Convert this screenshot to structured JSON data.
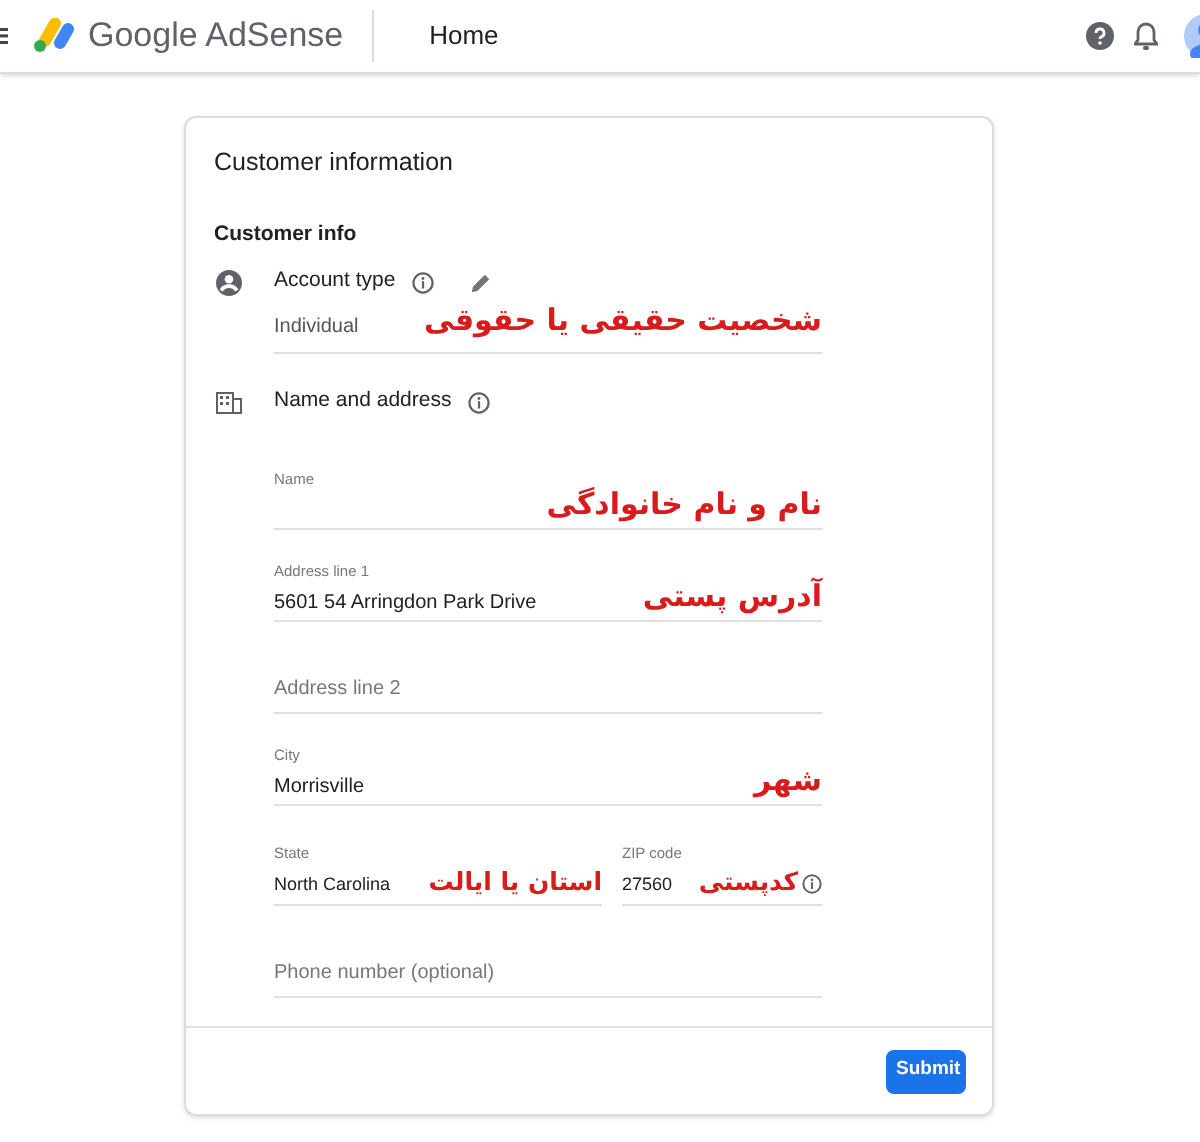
{
  "header": {
    "product": "Google AdSense",
    "page": "Home"
  },
  "card": {
    "title": "Customer information",
    "section": "Customer info",
    "account": {
      "label": "Account type",
      "value": "Individual",
      "annotation": "شخصیت حقیقی یا حقوقی"
    },
    "address_heading": "Name and address",
    "fields": [
      {
        "kind": "filled",
        "label": "Name",
        "annotation": "نام و نام خانوادگی"
      },
      {
        "kind": "filled",
        "label": "Address line 1",
        "value": "5601  54 Arringdon Park Drive",
        "annotation": "آدرس پستی"
      },
      {
        "kind": "empty",
        "placeholder": "Address line 2"
      },
      {
        "kind": "filled",
        "label": "City",
        "value": "Morrisville",
        "annotation": "شهر"
      }
    ],
    "state": {
      "label": "State",
      "value": "North Carolina",
      "annotation": "استان یا ایالت"
    },
    "zip": {
      "label": "ZIP code",
      "value": "27560",
      "annotation": "کدپستی"
    },
    "phone": {
      "placeholder": "Phone number (optional)"
    },
    "submit": "Submit"
  }
}
